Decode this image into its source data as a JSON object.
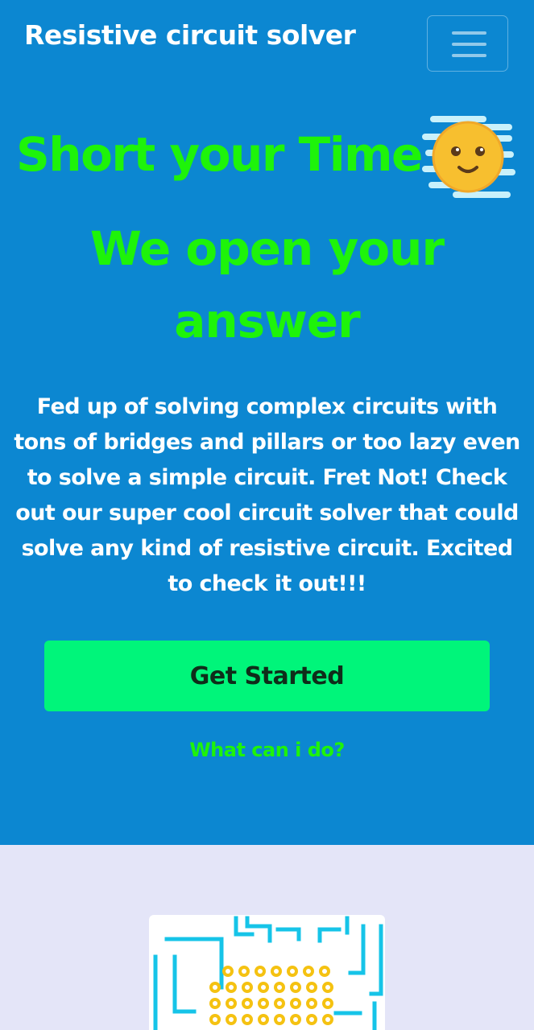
{
  "navbar": {
    "brand": "Resistive circuit solver",
    "menu_icon": "hamburger-menu-icon"
  },
  "hero": {
    "headline": "Short your Time",
    "headline_icon": "smiling-face-emoji-icon",
    "subheadline": "We open your answer",
    "description": "Fed up of solving complex circuits with tons of bridges and pillars or too lazy even to solve a simple circuit. Fret Not! Check out our super cool circuit solver that could solve any kind of resistive circuit. Excited to check it out!!!",
    "cta_label": "Get Started",
    "secondary_link": "What can i do?"
  },
  "features": {
    "image_icon": "circuit-board-illustration"
  },
  "colors": {
    "hero_background": "#0c87d1",
    "accent_green": "#1ef30a",
    "button_green": "#00f57a",
    "lower_background": "#e4e5f8"
  }
}
